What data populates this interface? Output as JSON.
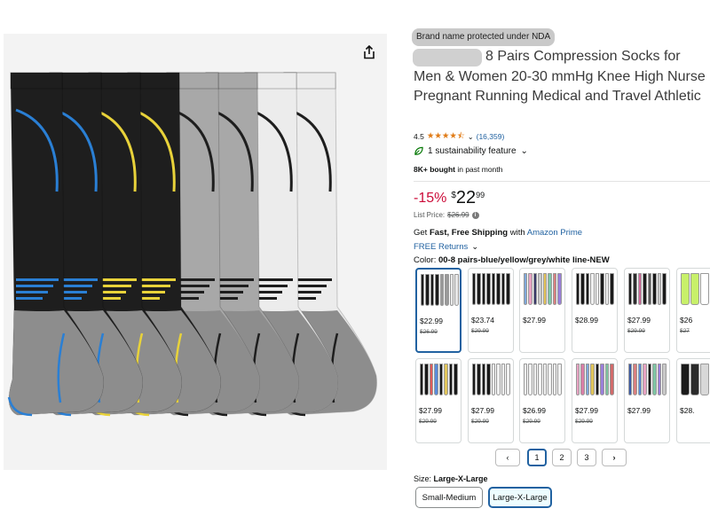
{
  "product": {
    "brand_badge": "Brand name protected under NDA",
    "title": "8 Pairs Compression Socks for Men & Women 20-30 mmHg Knee High Nurse Pregnant Running Medical and Travel Athletic",
    "rating": "4.5",
    "stars": "★★★★⯪",
    "review_count": "(16,359)",
    "sustainability": "1 sustainability feature",
    "bought_bold": "8K+ bought",
    "bought_rest": " in past month",
    "discount": "-15%",
    "price_symbol": "$",
    "price_whole": "22",
    "price_fraction": "99",
    "list_price_label": "List Price:",
    "list_price": "$26.99",
    "shipping_a": "Get ",
    "shipping_bold": "Fast, Free Shipping",
    "shipping_b": " with ",
    "shipping_link": "Amazon Prime",
    "returns": "FREE Returns",
    "color_label": "Color: ",
    "color_value": "00-8 pairs-blue/yellow/grey/white line-NEW",
    "size_label": "Size: ",
    "size_value": "Large-X-Large"
  },
  "swatches": [
    {
      "price": "$22.99",
      "list": "$26.99",
      "colors": [
        "#1c1c1c",
        "#1c1c1c",
        "#1c1c1c",
        "#1c1c1c",
        "#9a9a9a",
        "#9a9a9a",
        "#e8e8e8",
        "#e8e8e8"
      ]
    },
    {
      "price": "$23.74",
      "list": "$29.99",
      "colors": [
        "#1a1a1a",
        "#1a1a1a",
        "#1a1a1a",
        "#1a1a1a",
        "#1a1a1a",
        "#1a1a1a",
        "#1a1a1a",
        "#1a1a1a"
      ]
    },
    {
      "price": "$27.99",
      "list": "",
      "colors": [
        "#7fa7d9",
        "#e7a3c3",
        "#3b3b6b",
        "#c8c8c8",
        "#e6c45a",
        "#7fc6a4",
        "#d97f7f",
        "#9a7fd9"
      ]
    },
    {
      "price": "$28.99",
      "list": "",
      "colors": [
        "#1a1a1a",
        "#1a1a1a",
        "#1a1a1a",
        "#f0f0f0",
        "#f0f0f0",
        "#1a1a1a",
        "#f0f0f0",
        "#1a1a1a"
      ]
    },
    {
      "price": "$27.99",
      "list": "$29.99",
      "colors": [
        "#1a1a1a",
        "#2a2a2a",
        "#d06a9a",
        "#1a1a1a",
        "#5a5a5a",
        "#1a1a1a",
        "#c8c8c8",
        "#1a1a1a"
      ]
    },
    {
      "price": "$26",
      "list": "$27",
      "colors": [
        "#c8f06a",
        "#c8f06a",
        "#ffffff",
        "#ffffff"
      ]
    },
    {
      "price": "$27.99",
      "list": "$29.99",
      "colors": [
        "#1a1a1a",
        "#1a1a1a",
        "#e05a5a",
        "#5a8ad9",
        "#1a1a1a",
        "#e0c45a",
        "#1a1a1a",
        "#1a1a1a"
      ]
    },
    {
      "price": "$27.99",
      "list": "$29.99",
      "colors": [
        "#1a1a1a",
        "#1a1a1a",
        "#1a1a1a",
        "#1a1a1a",
        "#f0f0f0",
        "#f0f0f0",
        "#f0f0f0",
        "#f0f0f0"
      ]
    },
    {
      "price": "$26.99",
      "list": "$29.99",
      "colors": [
        "#f2f2f2",
        "#f2f2f2",
        "#f2f2f2",
        "#f2f2f2",
        "#f2f2f2",
        "#f2f2f2",
        "#f2f2f2",
        "#f2f2f2"
      ]
    },
    {
      "price": "$27.99",
      "list": "$29.99",
      "colors": [
        "#e7a3c3",
        "#d97fa7",
        "#7fa7d9",
        "#e0c45a",
        "#1a1a1a",
        "#9a7fd9",
        "#7fc6a4",
        "#d06a6a"
      ]
    },
    {
      "price": "$27.99",
      "list": "",
      "colors": [
        "#3b5ba9",
        "#d97f7f",
        "#5a8ad9",
        "#e7a3c3",
        "#1a1a1a",
        "#7fc6a4",
        "#9a7fd9",
        "#c8c8c8"
      ]
    },
    {
      "price": "$28.",
      "list": "",
      "colors": [
        "#1a1a1a",
        "#2a2a2a",
        "#d8d8d8",
        "#d8d8d8"
      ]
    }
  ],
  "pagination": {
    "prev": "‹",
    "pages": [
      "1",
      "2",
      "3"
    ],
    "next": "›",
    "current": "1"
  },
  "sizes": [
    {
      "label": "Small-Medium",
      "selected": false
    },
    {
      "label": "Large-X-Large",
      "selected": true
    }
  ],
  "hero_socks": [
    {
      "color": "#1e1e1e",
      "accent": "#2a7fd4"
    },
    {
      "color": "#1e1e1e",
      "accent": "#2a7fd4"
    },
    {
      "color": "#1e1e1e",
      "accent": "#e8d23a"
    },
    {
      "color": "#1e1e1e",
      "accent": "#e8d23a"
    },
    {
      "color": "#a8a8a8",
      "accent": "#1e1e1e"
    },
    {
      "color": "#a8a8a8",
      "accent": "#1e1e1e"
    },
    {
      "color": "#ececec",
      "accent": "#1e1e1e"
    },
    {
      "color": "#ececec",
      "accent": "#1e1e1e"
    }
  ],
  "theme": {
    "link": "#2162a1",
    "discount": "#cc0c39",
    "star": "#e07b16",
    "selected_border": "#2162a1"
  },
  "icons": {
    "share": "share-icon",
    "leaf": "leaf-icon",
    "chevron": "chevron-down-icon",
    "info": "info-icon"
  }
}
